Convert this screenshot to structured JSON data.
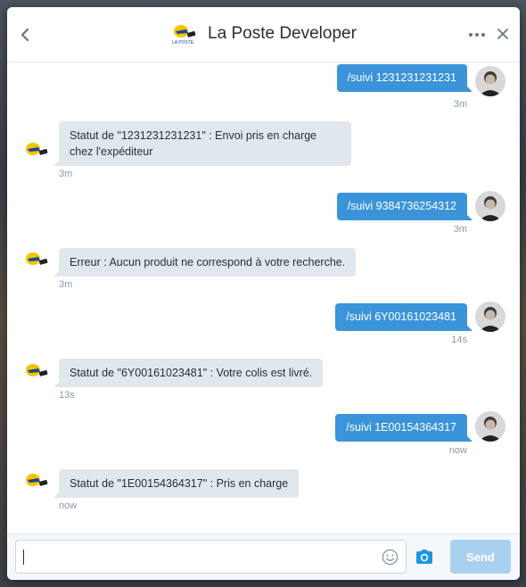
{
  "header": {
    "title": "La Poste Developer"
  },
  "messages": [
    {
      "dir": "out",
      "text": "/suivi 1231231231231",
      "time": "3m"
    },
    {
      "dir": "in",
      "text": "Statut de \"1231231231231\" : Envoi pris en charge chez l'expéditeur",
      "time": "3m"
    },
    {
      "dir": "out",
      "text": "/suivi 9384736254312",
      "time": "3m"
    },
    {
      "dir": "in",
      "text": "Erreur : Aucun produit ne correspond à votre recherche.",
      "time": "3m"
    },
    {
      "dir": "out",
      "text": "/suivi 6Y00161023481",
      "time": "14s"
    },
    {
      "dir": "in",
      "text": "Statut de \"6Y00161023481\" : Votre colis est livré.",
      "time": "13s"
    },
    {
      "dir": "out",
      "text": "/suivi 1E00154364317",
      "time": "now"
    },
    {
      "dir": "in",
      "text": "Statut de \"1E00154364317\" : Pris en charge",
      "time": "now"
    }
  ],
  "composer": {
    "value": "",
    "send_label": "Send"
  },
  "colors": {
    "outgoing_bubble": "#3b94d9",
    "incoming_bubble": "#e1e8ed",
    "send_button": "#a9d1ef",
    "brand_yellow": "#f5c400"
  },
  "icons": {
    "back": "chevron-left-icon",
    "more": "more-dots-icon",
    "close": "close-icon",
    "emoji": "emoji-icon",
    "camera": "camera-icon"
  }
}
